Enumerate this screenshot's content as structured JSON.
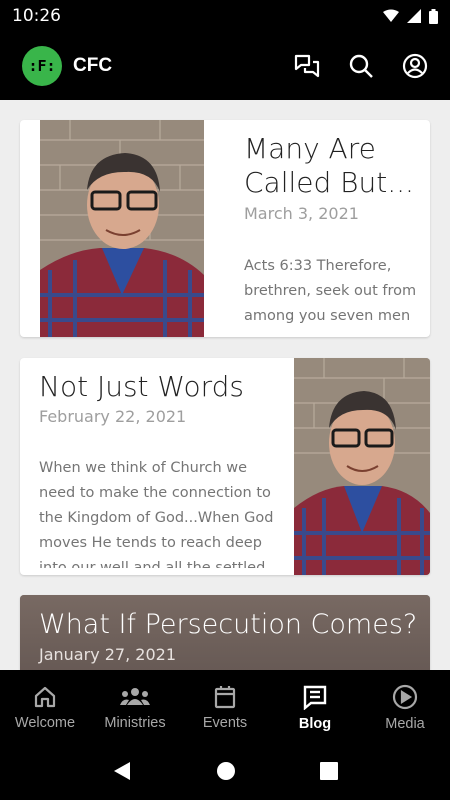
{
  "status_bar": {
    "time": "10:26"
  },
  "app_bar": {
    "logo_text": ":F:",
    "title": "CFC"
  },
  "posts": [
    {
      "title": "Many Are Called But...",
      "date": "March 3, 2021",
      "excerpt": "Acts 6:33 Therefore, brethren, seek out from among you seven men"
    },
    {
      "title": "Not Just Words",
      "date": "February 22, 2021",
      "excerpt": "When we think of Church we need to make the connection to the Kingdom of God...When God moves He tends to reach deep into our well and all the settled"
    },
    {
      "title": "What If Persecution Comes?",
      "date": "January 27, 2021"
    }
  ],
  "bottom_nav": {
    "items": [
      {
        "label": "Welcome",
        "icon": "home-icon"
      },
      {
        "label": "Ministries",
        "icon": "groups-icon"
      },
      {
        "label": "Events",
        "icon": "calendar-icon"
      },
      {
        "label": "Blog",
        "icon": "article-icon",
        "active": true
      },
      {
        "label": "Media",
        "icon": "play-circle-icon"
      }
    ]
  },
  "colors": {
    "accent": "#39b54a",
    "bar_bg": "#000000",
    "page_bg": "#eeeeee"
  }
}
